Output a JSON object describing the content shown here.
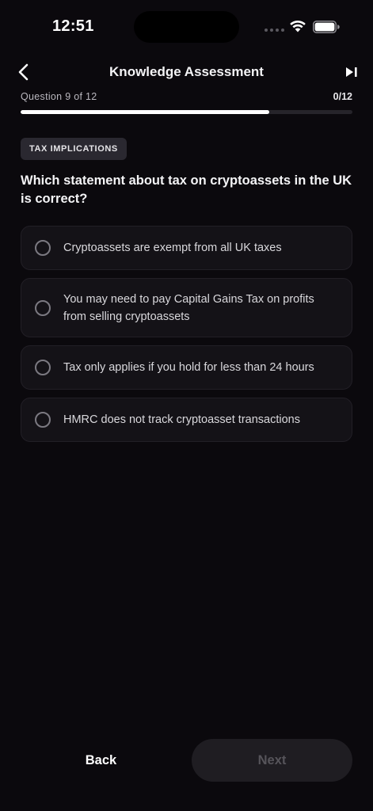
{
  "status_bar": {
    "time": "12:51"
  },
  "header": {
    "title": "Knowledge Assessment",
    "back_icon": "chevron-left-icon",
    "skip_icon": "skip-forward-icon"
  },
  "progress": {
    "label": "Question 9 of 12",
    "count": "0/12",
    "fill_fraction": 0.75
  },
  "question": {
    "category": "TAX IMPLICATIONS",
    "text": "Which statement about tax on cryptoassets in the UK is correct?",
    "options": [
      {
        "label": "Cryptoassets are exempt from all UK taxes",
        "selected": false
      },
      {
        "label": "You may need to pay Capital Gains Tax on profits from selling cryptoassets",
        "selected": false
      },
      {
        "label": "Tax only applies if you hold for less than 24 hours",
        "selected": false
      },
      {
        "label": "HMRC does not track cryptoasset transactions",
        "selected": false
      }
    ]
  },
  "footer": {
    "back_label": "Back",
    "next_label": "Next",
    "next_enabled": false
  },
  "colors": {
    "background": "#0b090d",
    "option_background": "#141217",
    "progress_fill": "#ffffff",
    "next_disabled_background": "#1f1d22",
    "next_disabled_text": "#56545a"
  }
}
